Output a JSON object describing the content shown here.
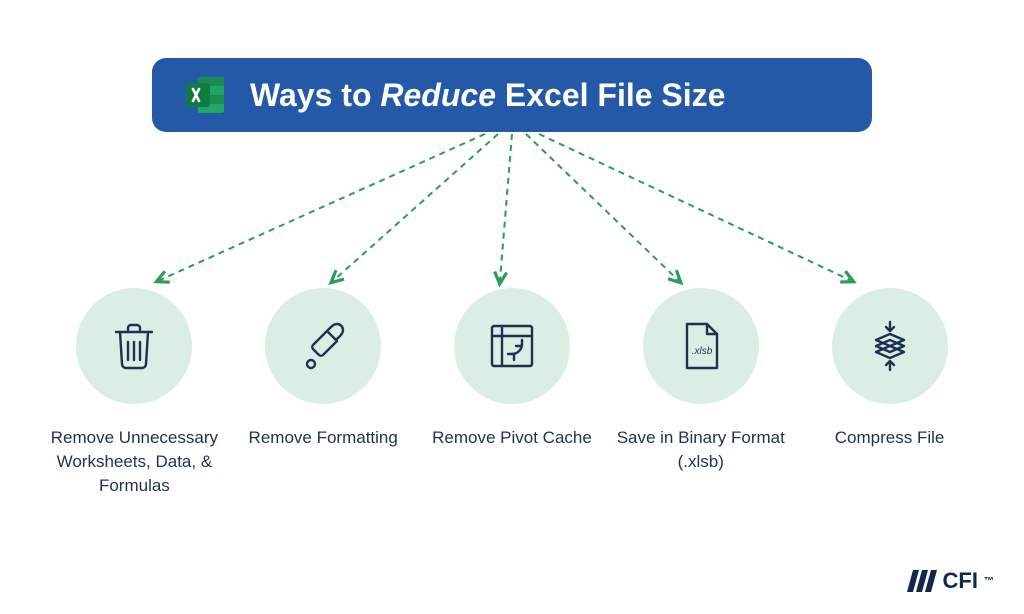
{
  "title": {
    "prefix": "Ways to ",
    "emphasis": "Reduce",
    "suffix": " Excel File Size"
  },
  "methods": [
    {
      "id": "trash",
      "label": "Remove Unnecessary Worksheets, Data, & Formulas"
    },
    {
      "id": "dropper",
      "label": "Remove Formatting"
    },
    {
      "id": "pivot",
      "label": "Remove Pivot Cache"
    },
    {
      "id": "file",
      "label": "Save in Binary Format (.xlsb)",
      "file_ext": ".xlsb"
    },
    {
      "id": "compress",
      "label": "Compress File"
    }
  ],
  "logo": {
    "text": "CFI"
  },
  "colors": {
    "title_bg": "#2359a6",
    "circle_bg": "#dbeee3",
    "arrow": "#2c9b5a",
    "text_dark": "#1e3055",
    "icon_stroke": "#1e3055"
  }
}
